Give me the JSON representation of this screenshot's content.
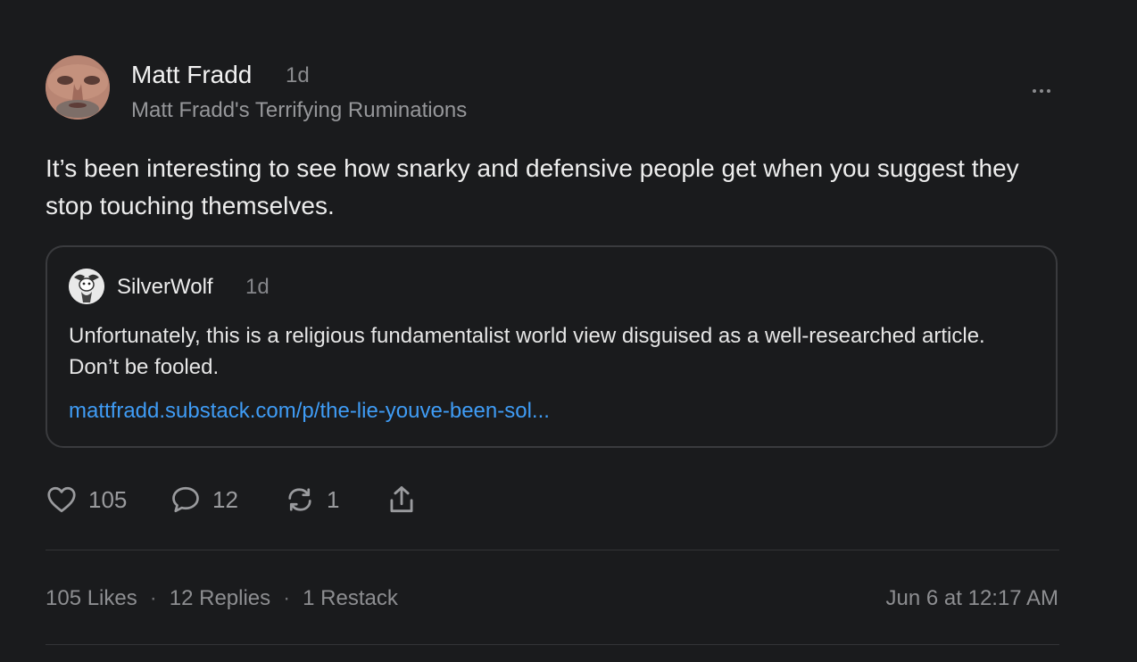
{
  "post": {
    "author": "Matt Fradd",
    "time": "1d",
    "publication": "Matt Fradd's Terrifying Ruminations",
    "body": "It’s been interesting to see how snarky and defensive people get when you suggest they stop touching themselves."
  },
  "quote": {
    "author": "SilverWolf",
    "time": "1d",
    "body": "Unfortunately, this is a religious fundamentalist world view disguised as a well-researched article. Don’t be fooled.",
    "link": "mattfradd.substack.com/p/the-lie-youve-been-sol..."
  },
  "actions": {
    "likes": "105",
    "replies": "12",
    "restacks": "1"
  },
  "stats": {
    "likes": "105 Likes",
    "replies": "12 Replies",
    "restacks": "1 Restack",
    "separator": "·",
    "timestamp": "Jun 6 at 12:17 AM"
  },
  "icons": {
    "more": "more-horizontal-icon",
    "like": "heart-icon",
    "reply": "comment-icon",
    "restack": "restack-icon",
    "share": "share-icon"
  },
  "colors": {
    "background": "#1a1b1d",
    "link": "#3f9cf5",
    "muted": "#8d8e91"
  }
}
